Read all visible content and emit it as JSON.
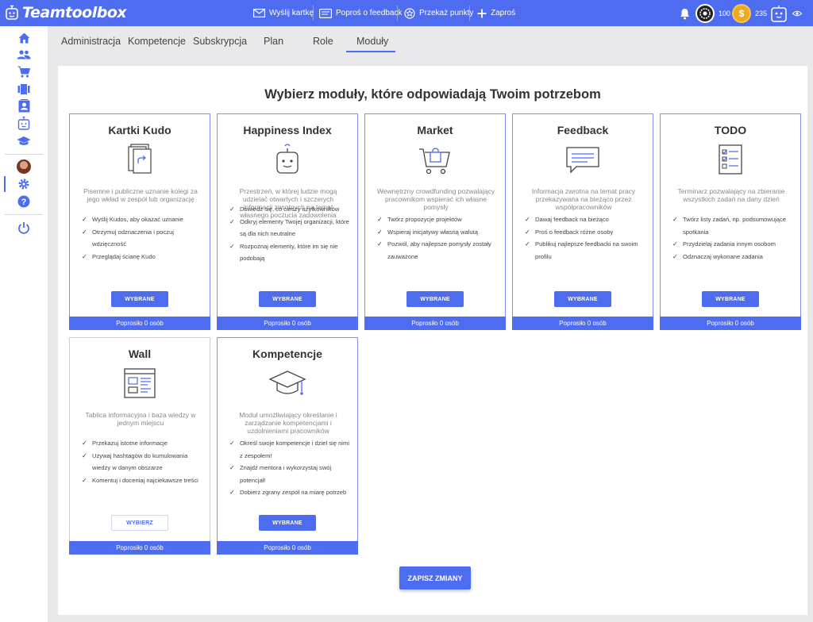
{
  "brand": {
    "name": "Teamtoolbox",
    "accent": "#4d6cf0"
  },
  "topbar": {
    "actions": [
      {
        "label": "Wyślij kartkę",
        "icon": "envelope-icon"
      },
      {
        "label": "Poproś o feedback",
        "icon": "feedback-icon"
      },
      {
        "label": "Przekaż punkty",
        "icon": "points-icon"
      },
      {
        "label": "Zaproś",
        "icon": "plus-icon"
      }
    ],
    "points_value": "100",
    "coins_value": "235"
  },
  "sidebar": {
    "icons": [
      "home-icon",
      "people-icon",
      "cart-icon",
      "kudo-icon",
      "contact-icon",
      "happiness-icon",
      "graduation-icon",
      "avatar",
      "settings-icon",
      "help-icon",
      "power-icon"
    ]
  },
  "tabs": [
    "Administracja",
    "Kompetencje",
    "Subskrypcja",
    "Plan",
    "Role",
    "Moduły"
  ],
  "active_tab": "Moduły",
  "heading": "Wybierz moduły, które odpowiadają Twoim potrzebom",
  "cards": [
    {
      "title": "Kartki Kudo",
      "desc": "Pisemne i publiczne uznanie kolegi za jego wkład w zespół lub organizację",
      "bullets": [
        "Wyślij Kudos, aby okazać uznanie",
        "Otrzymuj odznaczenia i poczuj wdzięczność",
        "Przeglądaj ścianę Kudo"
      ],
      "button": "WYBRANE",
      "footer": "Poprosiło 0 osób"
    },
    {
      "title": "Happiness Index",
      "desc": "Przestrzeń, w której ludzie mogą udzielać otwartych i szczerych informacji zwrotnych na temat własnego poczucia zadowolenia",
      "bullets": [
        "Dowiedz się, co cieszy użytkowników",
        "Odkryj elementy Twojej organizacji, które są dla nich neutralne",
        "Rozpoznaj elementy, które im się nie podobają"
      ],
      "button": "WYBRANE",
      "footer": "Poprosiło 0 osób"
    },
    {
      "title": "Market",
      "desc": "Wewnętrzny crowdfunding pozwalający pracownikom wspierać ich własne pomysły",
      "bullets": [
        "Twórz propozycje projektów",
        "Wspieraj inicjatywy własną walutą",
        "Pozwól, aby najlepsze pomysły zostały zauważone"
      ],
      "button": "WYBRANE",
      "footer": "Poprosiło 0 osób"
    },
    {
      "title": "Feedback",
      "desc": "Informacja zwrotna na temat pracy przekazywana na bieżąco przez współpracowników",
      "bullets": [
        "Dawaj feedback na bieżąco",
        "Proś o feedback różne osoby",
        "Publikuj najlepsze feedbacki na swoim profilu"
      ],
      "button": "WYBRANE",
      "footer": "Poprosiło 0 osób"
    },
    {
      "title": "TODO",
      "desc": "Terminarz pozwalający na zbieranie wszystkich zadań na dany dzień",
      "bullets": [
        "Twórz listy zadań, np. podsumowujące spotkania",
        "Przydzielaj zadania innym osobom",
        "Odznaczaj wykonane zadania"
      ],
      "button": "WYBRANE",
      "footer": "Poprosiło 0 osób"
    },
    {
      "title": "Wall",
      "desc": "Tablica informacyjna i baza wiedzy w jednym miejscu",
      "bullets": [
        "Przekazuj istotne informacje",
        "Używaj hashtagów do kumulowania wiedzy w danym obszarze",
        "Komentuj i doceniaj najciekawsze treści"
      ],
      "button": "WYBIERZ",
      "footer": "Poprosiło 0 osób"
    },
    {
      "title": "Kompetencje",
      "desc": "Moduł umożliwiający określanie i zarządzanie kompetencjami i uzdolnieniami pracowników",
      "bullets": [
        "Określ swoje kompetencje i dziel się nimi z zespołem!",
        "Znajdź mentora i wykorzystaj swój potencjał!",
        "Dobierz zgrany zespół na miarę potrzeb"
      ],
      "button": "WYBRANE",
      "footer": "Poprosiło 0 osób"
    }
  ],
  "save_button": "ZAPISZ ZMIANY"
}
